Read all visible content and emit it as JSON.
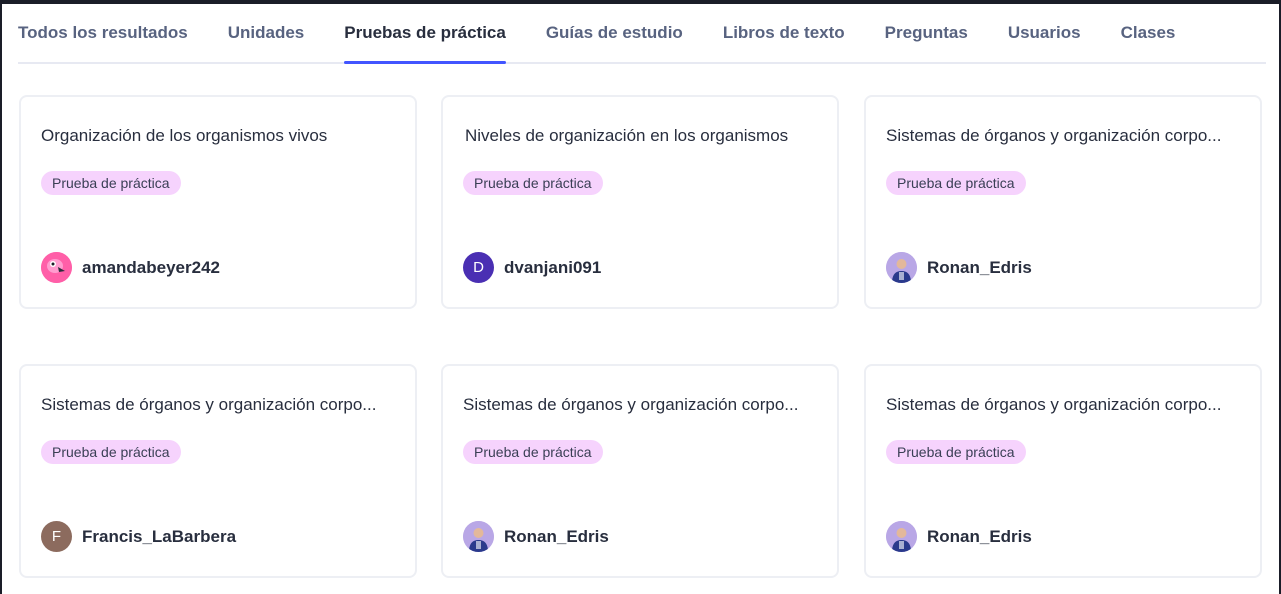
{
  "tabs": [
    {
      "label": "Todos los resultados"
    },
    {
      "label": "Unidades"
    },
    {
      "label": "Pruebas de práctica"
    },
    {
      "label": "Guías de estudio"
    },
    {
      "label": "Libros de texto"
    },
    {
      "label": "Preguntas"
    },
    {
      "label": "Usuarios"
    },
    {
      "label": "Clases"
    }
  ],
  "active_tab": "Pruebas de práctica",
  "colors": {
    "accent": "#4255ff",
    "badge_bg": "#f6d3fd",
    "avatar_dvanjani": "#4a2fb3",
    "avatar_francis": "#8c6b5e"
  },
  "cards": [
    {
      "title": "Organización de los organismos vivos",
      "badge": "Prueba de práctica",
      "author": "amandabeyer242",
      "avatar_icon": "flamingo-avatar-icon"
    },
    {
      "title": "Niveles de organización en los organismos",
      "badge": "Prueba de práctica",
      "author": "dvanjani091",
      "avatar_letter": "D"
    },
    {
      "title": "Sistemas de órganos y organización corpo...",
      "badge": "Prueba de práctica",
      "author": "Ronan_Edris",
      "avatar_icon": "person-photo-avatar-icon"
    },
    {
      "title": "Sistemas de órganos y organización corpo...",
      "badge": "Prueba de práctica",
      "author": "Francis_LaBarbera",
      "avatar_letter": "F"
    },
    {
      "title": "Sistemas de órganos y organización corpo...",
      "badge": "Prueba de práctica",
      "author": "Ronan_Edris",
      "avatar_icon": "person-photo-avatar-icon"
    },
    {
      "title": "Sistemas de órganos y organización corpo...",
      "badge": "Prueba de práctica",
      "author": "Ronan_Edris",
      "avatar_icon": "person-photo-avatar-icon"
    }
  ]
}
